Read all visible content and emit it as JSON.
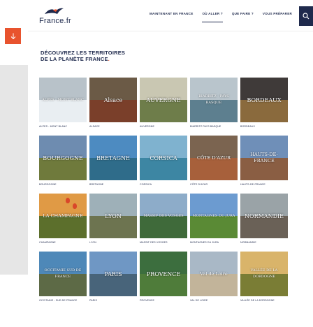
{
  "brand": {
    "name": "France.fr"
  },
  "nav": [
    {
      "label": "MAINTENANT EN FRANCE",
      "active": false
    },
    {
      "label": "OÙ ALLER ?",
      "active": true
    },
    {
      "label": "QUE FAIRE ?",
      "active": false
    },
    {
      "label": "VOUS PRÉPARER",
      "active": false
    }
  ],
  "icons": {
    "search": "search-icon",
    "scroll": "arrow-down-icon"
  },
  "heading": {
    "line1": "DÉCOUVREZ LES TERRITOIRES",
    "line2": "DE LA PLANÈTE FRANCE",
    "dot": "."
  },
  "colors": {
    "accent": "#e8532e",
    "navy": "#1f2a4d"
  },
  "regions": [
    {
      "overlay": "ALPES - MONT BLANC",
      "caption": "ALPES - MONT BLANC",
      "sky": "#b8c2c9",
      "land": "#e9eef2"
    },
    {
      "overlay": "Alsace",
      "caption": "ALSACE",
      "sky": "#6b5a46",
      "land": "#7a3f2a"
    },
    {
      "overlay": "AUVERGNE",
      "caption": "AUVERGNE",
      "sky": "#c9c7b2",
      "land": "#6e7d4a"
    },
    {
      "overlay": "BIARRITZ - PAYS BASQUE",
      "caption": "BIARRITZ PAYS BASQUE",
      "sky": "#b9c5cc",
      "land": "#5d7f8f"
    },
    {
      "overlay": "BORDEAUX",
      "caption": "BORDEAUX",
      "sky": "#3f3a39",
      "land": "#8a6a3d"
    },
    {
      "overlay": "BOURGOGNE",
      "caption": "BOURGOGNE",
      "sky": "#6e8cb0",
      "land": "#6f7a3c"
    },
    {
      "overlay": "BRETAGNE",
      "caption": "BRETAGNE",
      "sky": "#4d8bc1",
      "land": "#2f6c8a"
    },
    {
      "overlay": "CORSICA",
      "caption": "CORSICA",
      "sky": "#7fb2cf",
      "land": "#3d86a3"
    },
    {
      "overlay": "CÔTE D'AZUR",
      "caption": "CÔTE D'AZUR",
      "sky": "#7b6450",
      "land": "#a7603b"
    },
    {
      "overlay": "HAUTS-DE-FRANCE",
      "caption": "HAUTS-DE-FRANCE",
      "sky": "#6f8fb8",
      "land": "#8a5e43"
    },
    {
      "overlay": "LA CHAMPAGNE",
      "caption": "CHAMPAGNE",
      "sky": "#e09a45",
      "land": "#5c6f2c"
    },
    {
      "overlay": "LYON",
      "caption": "LYON",
      "sky": "#9eb0b8",
      "land": "#6d7450"
    },
    {
      "overlay": "MASSIF DES VOSGES",
      "caption": "MASSIF DES VOSGES",
      "sky": "#8dacc9",
      "land": "#3f6a3a"
    },
    {
      "overlay": "MONTAGNES DU JURA",
      "caption": "MONTAGNES DU JURA",
      "sky": "#6c9bd0",
      "land": "#5a8a35"
    },
    {
      "overlay": "NORMANDIE",
      "caption": "NORMANDIE",
      "sky": "#9aa3a7",
      "land": "#6a6157"
    },
    {
      "overlay": "OCCITANIE SUD DE FRANCE",
      "caption": "OCCITANIE - SUD DE FRANCE",
      "sky": "#4e88b8",
      "land": "#5d6a46"
    },
    {
      "overlay": "PARIS",
      "caption": "PARIS",
      "sky": "#6f97c4",
      "land": "#48647a"
    },
    {
      "overlay": "PROVENCE",
      "caption": "PROVENCE",
      "sky": "#3c6e3e",
      "land": "#4f7c3a"
    },
    {
      "overlay": "Val de Loire",
      "caption": "VAL DE LOIRE",
      "sky": "#a9b8c6",
      "land": "#c2b49a"
    },
    {
      "overlay": "VALLÉE DE LA DORDOGNE",
      "caption": "VALLÉE DE LA DORDOGNE",
      "sky": "#d9b46a",
      "land": "#7a7d35"
    }
  ]
}
